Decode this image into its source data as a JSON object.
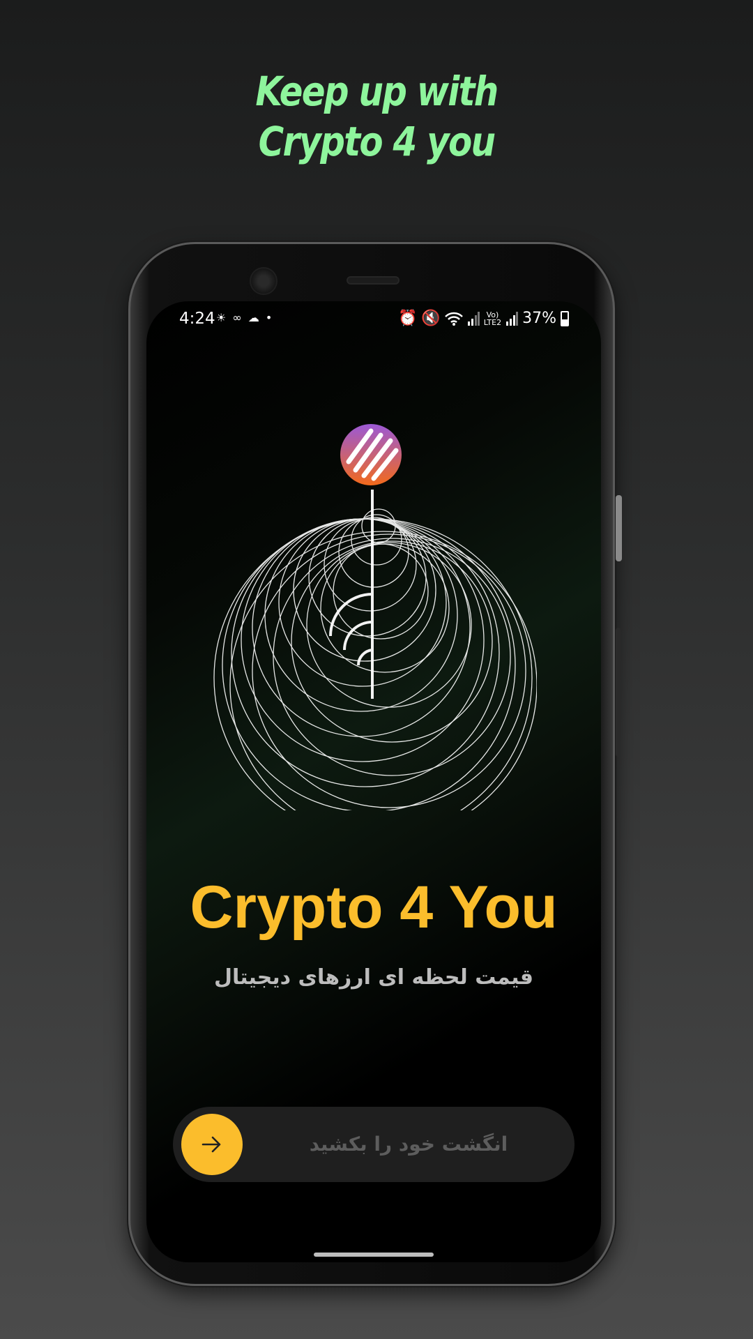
{
  "promo": {
    "line1": "Keep up with",
    "line2": "Crypto 4 you"
  },
  "status_bar": {
    "time": "4:24",
    "left_icons": "☀ ∞ ☁ •",
    "net_label_top": "Vo)",
    "net_label_bottom": "LTE2",
    "battery": "37%"
  },
  "app": {
    "title": "Crypto 4 You",
    "subtitle": "قیمت لحظه ای ارزهای دیجیتال"
  },
  "slider": {
    "label": "انگشت خود را بکشید",
    "icon": "arrow-right-icon"
  },
  "colors": {
    "accent": "#fbbd2c",
    "promo": "#8ef59c"
  }
}
